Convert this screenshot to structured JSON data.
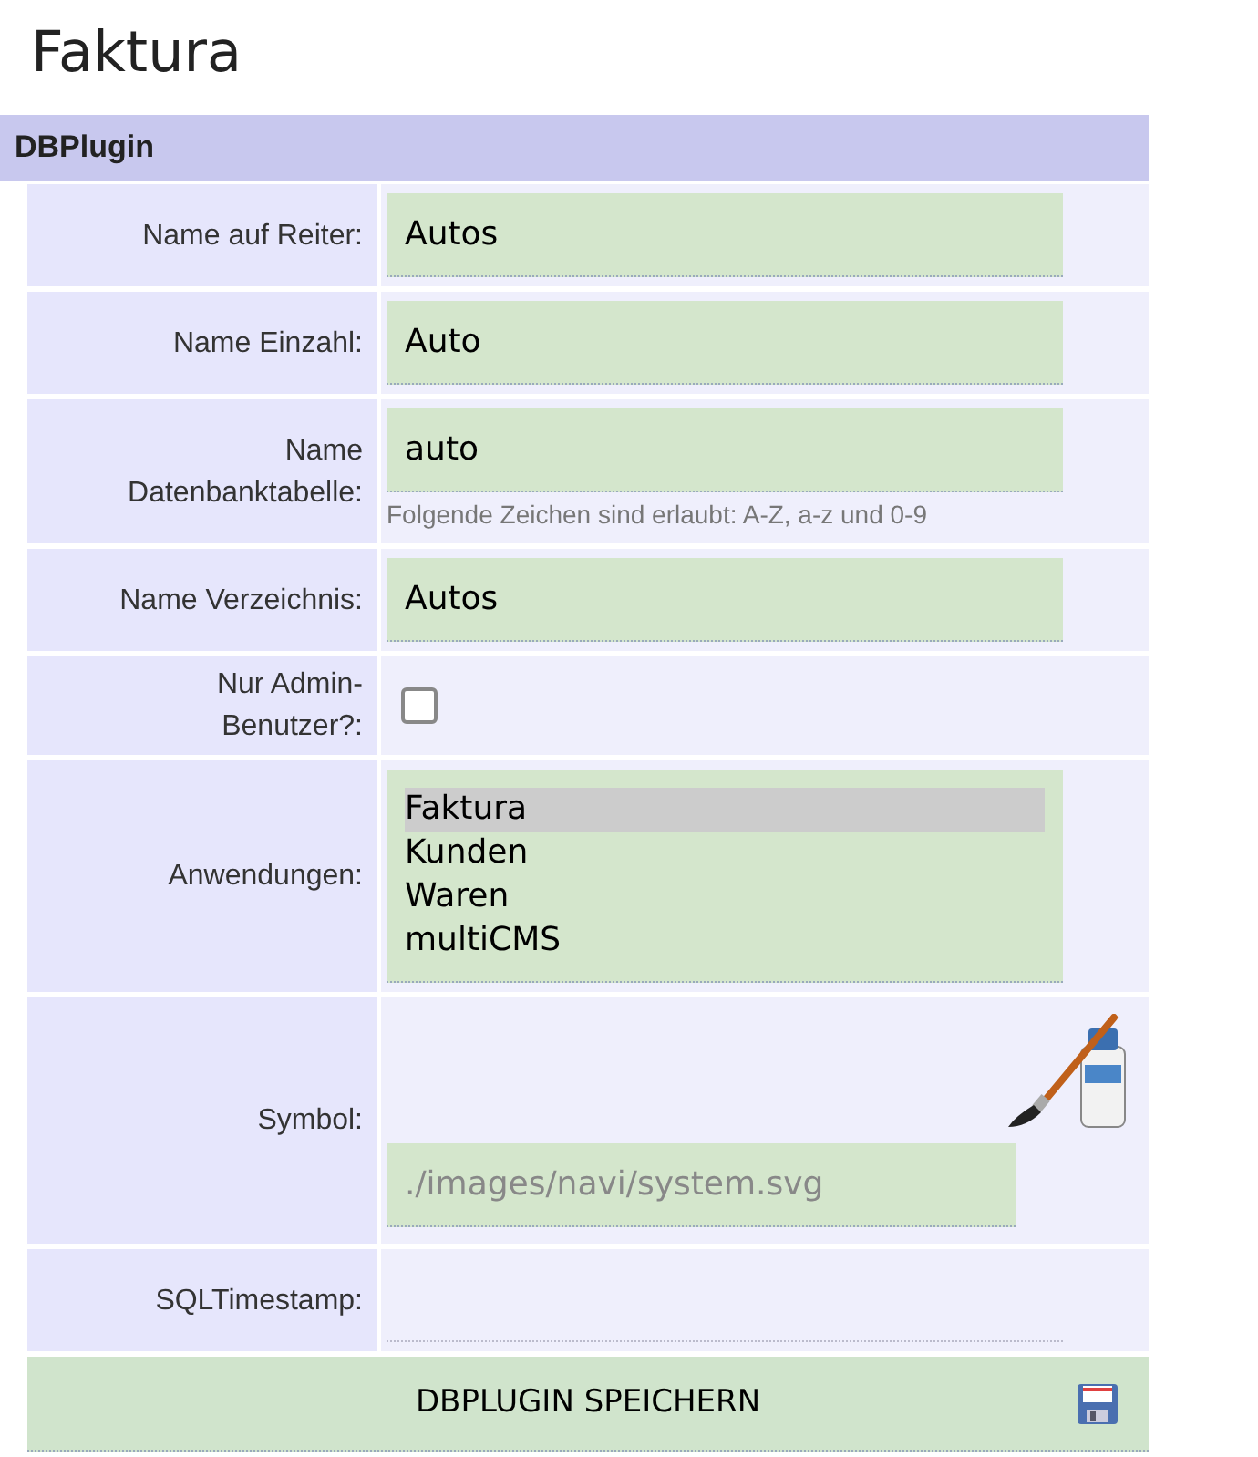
{
  "page_title": "Faktura",
  "section": {
    "title": "DBPlugin"
  },
  "rows": [
    {
      "kind": "text",
      "label": "Name auf Reiter:",
      "value": "Autos"
    },
    {
      "kind": "text",
      "label": "Name Einzahl:",
      "value": "Auto"
    },
    {
      "kind": "text",
      "label": "Name Datenbanktabelle:",
      "value": "auto",
      "hint": "Folgende Zeichen sind erlaubt: A-Z, a-z und 0-9"
    },
    {
      "kind": "text",
      "label": "Name Verzeichnis:",
      "value": "Autos"
    },
    {
      "kind": "checkbox",
      "label": "Nur Admin-Benutzer?:",
      "checked": false
    },
    {
      "kind": "listbox",
      "label": "Anwendungen:",
      "options": [
        {
          "label": "Faktura",
          "selected": true
        },
        {
          "label": "Kunden",
          "selected": false
        },
        {
          "label": "Waren",
          "selected": false
        },
        {
          "label": "multiCMS",
          "selected": false
        }
      ]
    },
    {
      "kind": "symbol",
      "label": "Symbol:",
      "placeholder": "./images/navi/system.svg"
    },
    {
      "kind": "plain",
      "label": "SQLTimestamp:"
    }
  ],
  "save_button": {
    "label": "DBPLUGIN SPEICHERN"
  }
}
